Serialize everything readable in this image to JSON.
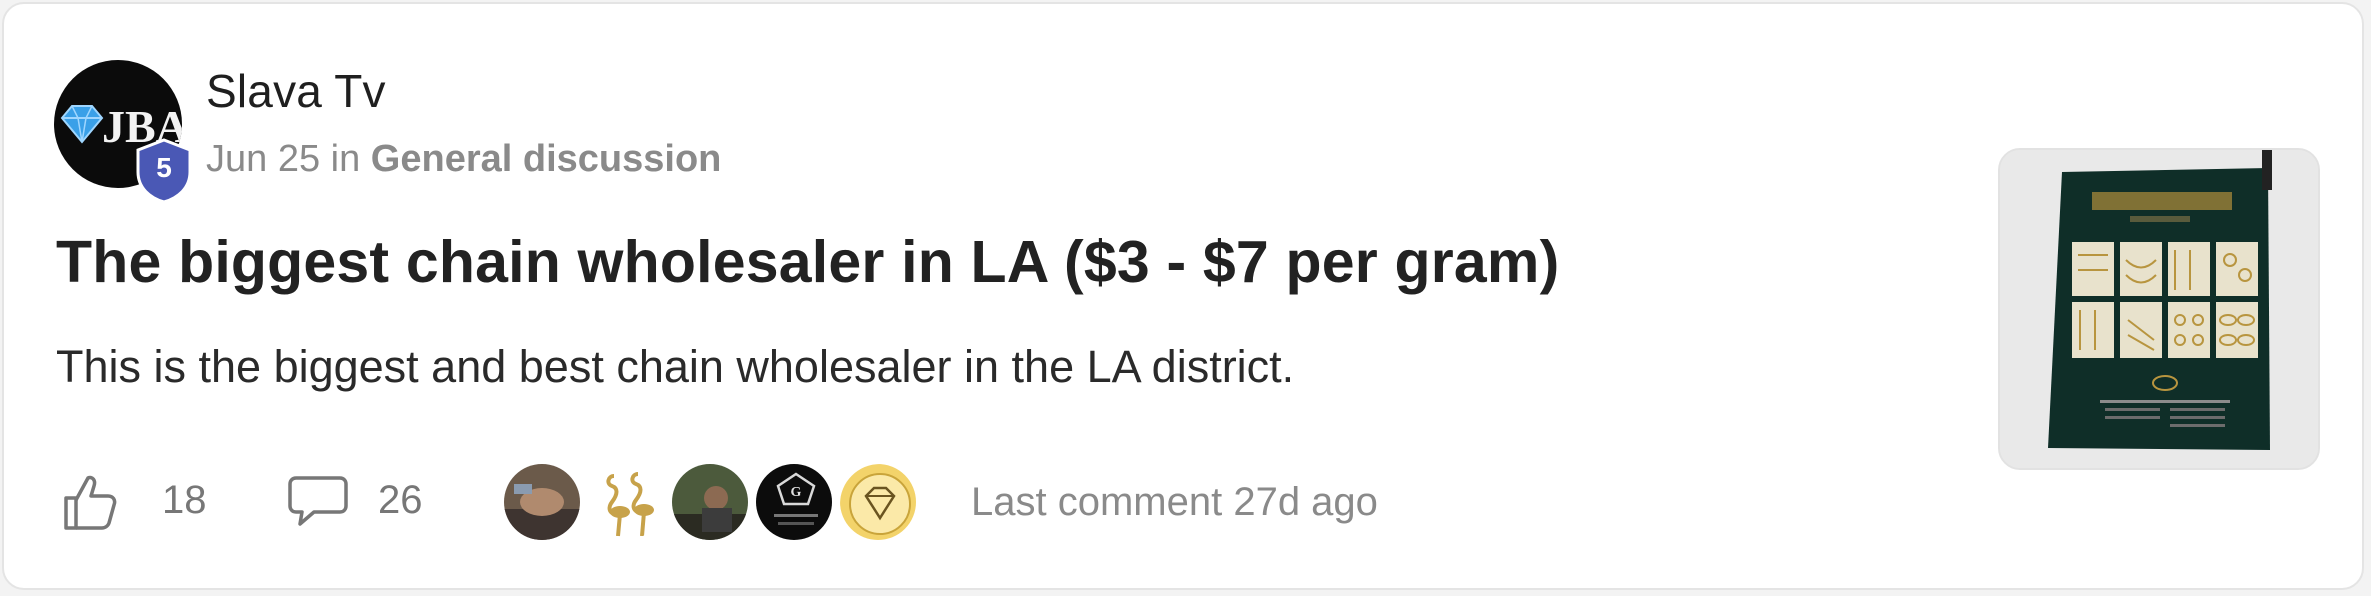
{
  "post": {
    "author": "Slava Tv",
    "level": "5",
    "date": "Jun 25",
    "in_word": "in",
    "category": "General discussion",
    "title": "The biggest chain wholesaler in LA ($3 - $7 per gram)",
    "excerpt": "This is the biggest and best chain wholesaler in the LA district.",
    "likes": "18",
    "comments": "26",
    "last_comment": "Last comment 27d ago",
    "avatar_logo_text": "JBA"
  },
  "icons": {
    "like": "thumbs-up-icon",
    "comment": "speech-bubble-icon",
    "level": "shield-badge-icon"
  },
  "colors": {
    "badge": "#4a58b5",
    "title": "#222222",
    "muted": "#8a8a8a",
    "border": "#e4e4e4"
  }
}
